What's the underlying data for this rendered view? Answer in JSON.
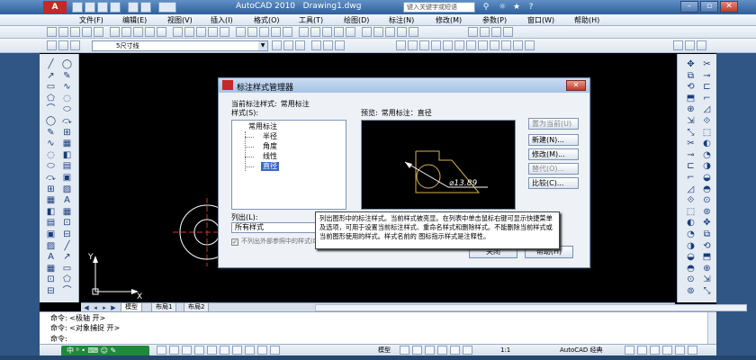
{
  "window": {
    "logo": "A",
    "title": "AutoCAD 2010",
    "filename": "Drawing1.dwg",
    "search_placeholder": "键入关键字或短语"
  },
  "menu": [
    {
      "label": "文件(F)"
    },
    {
      "label": "编辑(E)"
    },
    {
      "label": "视图(V)"
    },
    {
      "label": "插入(I)"
    },
    {
      "label": "格式(O)"
    },
    {
      "label": "工具(T)"
    },
    {
      "label": "绘图(D)"
    },
    {
      "label": "标注(N)"
    },
    {
      "label": "修改(M)"
    },
    {
      "label": "参数(P)"
    },
    {
      "label": "窗口(W)"
    },
    {
      "label": "帮助(H)"
    }
  ],
  "layer": {
    "value": "5尺寸线"
  },
  "dialog": {
    "title": "标注样式管理器",
    "close_label": "✕",
    "current_style_label": "当前标注样式:",
    "current_style_value": "常用标注",
    "styles_label": "样式(S):",
    "tree": {
      "root": "常用标注",
      "children": [
        {
          "label": "半径"
        },
        {
          "label": "角度"
        },
        {
          "label": "线性"
        },
        {
          "label": "直径"
        }
      ]
    },
    "preview_label": "预览:",
    "preview_value": "常用标注：直径",
    "preview_dimension": "⌀13.89",
    "buttons": {
      "set_current": "置为当前(U)",
      "new": "新建(N)...",
      "modify": "修改(M)...",
      "override": "替代(O)...",
      "compare": "比较(C)..."
    },
    "list_label": "列出(L):",
    "list_value": "所有样式",
    "exclude_xref": "不列出外部参照中的样式(D)",
    "close_button": "关闭",
    "help_button": "帮助(H)"
  },
  "tooltip": {
    "text": "列出图形中的标注样式。当前样式被亮显。在列表中单击鼠标右键可显示快捷菜单及选项，可用于设置当前标注样式、重命名样式和删除样式。不能删除当前样式或当前图形使用的样式。样式名前的 图标指示样式是注释性。"
  },
  "axes": {
    "y": "Y",
    "x": "X"
  },
  "layout_tabs": [
    {
      "label": "模型"
    },
    {
      "label": "布局1"
    },
    {
      "label": "布局2"
    }
  ],
  "command": {
    "line1": "命令:  <极轴 开>",
    "line2": "命令:  <对象捕捉 开>",
    "line3": "命令:"
  },
  "status": {
    "ime": "中 ⁰ • ⌨ ☺ ✎",
    "model": "模型",
    "scale": "1:1",
    "workspace": "AutoCAD 经典"
  },
  "colors": {
    "canvas": "#000000",
    "accent": "#c62828",
    "preview_lines": "#d6b24a"
  }
}
